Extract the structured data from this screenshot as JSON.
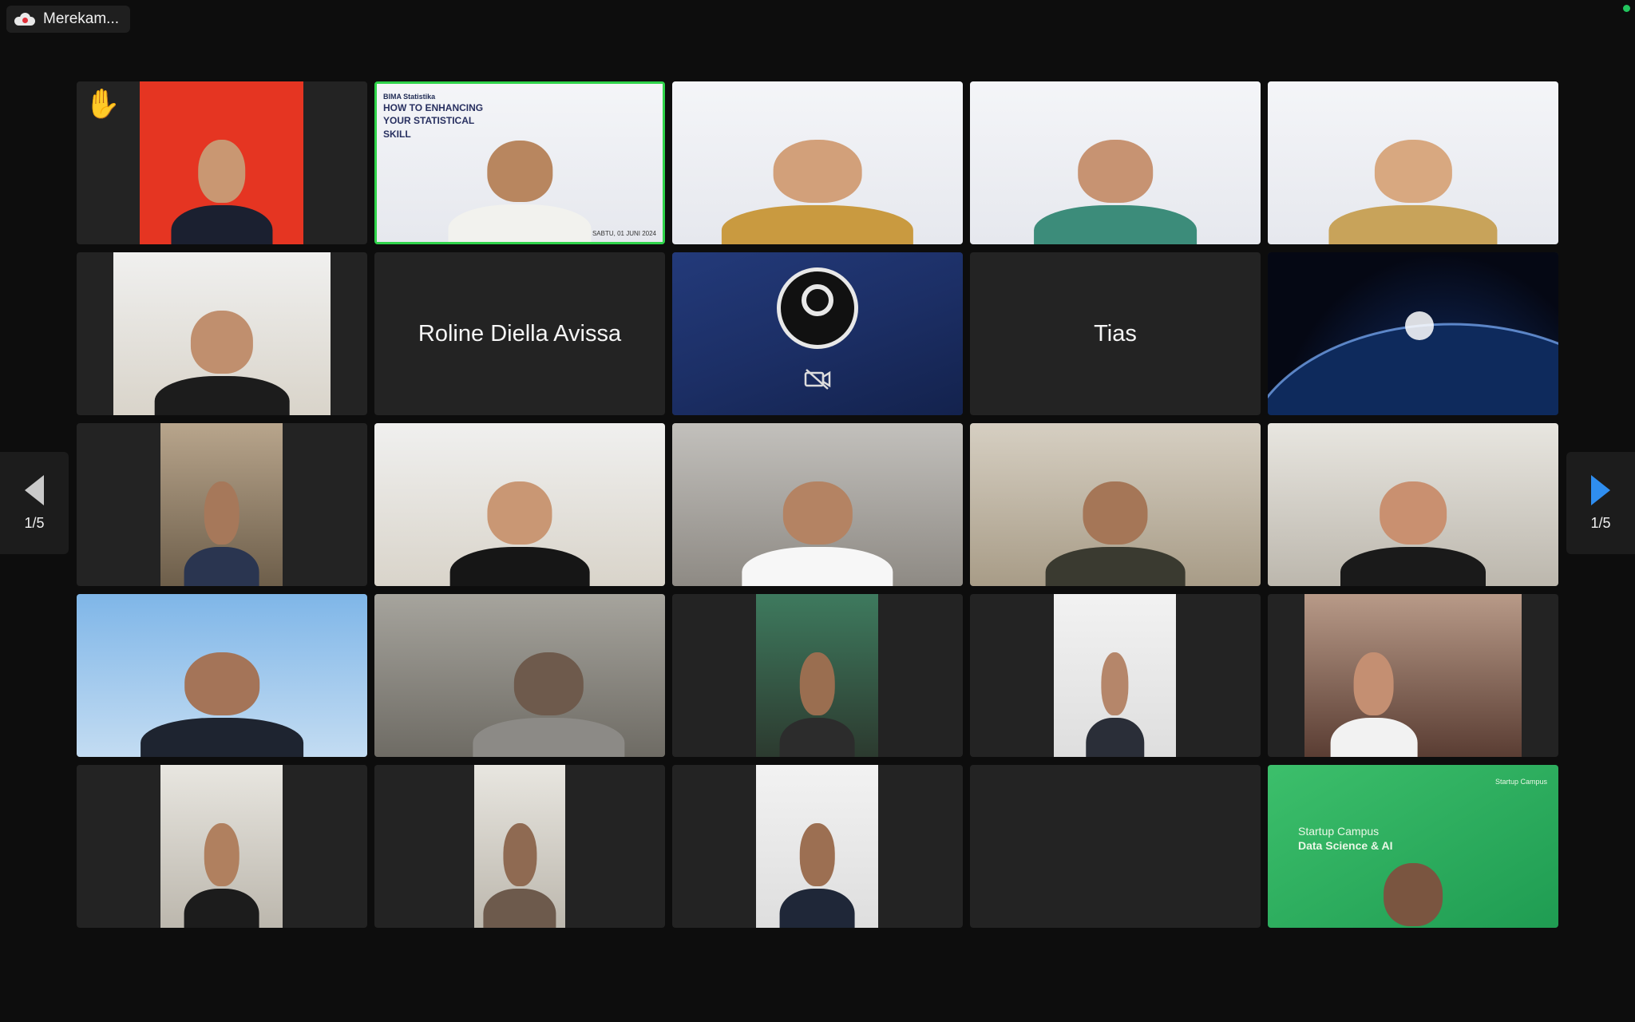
{
  "recording": {
    "label": "Merekam...",
    "icon": "cloud-record-icon"
  },
  "pagination": {
    "left_label": "1/5",
    "right_label": "1/5"
  },
  "tiles": [
    {
      "name": ""
    },
    {
      "name": "",
      "slide_brand": "BIMA Statistika",
      "slide_title": "HOW TO ENHANCING YOUR STATISTICAL SKILL",
      "slide_date": "SABTU, 01 JUNI 2024"
    },
    {
      "name": ""
    },
    {
      "name": ""
    },
    {
      "name": ""
    },
    {
      "name": ""
    },
    {
      "name": "Roline Diella Avissa"
    },
    {
      "name": ""
    },
    {
      "name": "Tias"
    },
    {
      "name": ""
    },
    {
      "name": ""
    },
    {
      "name": ""
    },
    {
      "name": ""
    },
    {
      "name": ""
    },
    {
      "name": ""
    },
    {
      "name": ""
    },
    {
      "name": ""
    },
    {
      "name": ""
    },
    {
      "name": ""
    },
    {
      "name": ""
    },
    {
      "name": ""
    },
    {
      "name": ""
    },
    {
      "name": ""
    },
    {
      "name": ""
    },
    {
      "name": "",
      "startup_title": "Startup Campus",
      "startup_subtitle": "Data Science & AI",
      "startup_brand": "Startup Campus"
    }
  ],
  "colors": {
    "active_speaker": "#2fd34a",
    "nav_arrow_active": "#2f8ef0",
    "nav_arrow_inactive": "#c9c9c9"
  }
}
